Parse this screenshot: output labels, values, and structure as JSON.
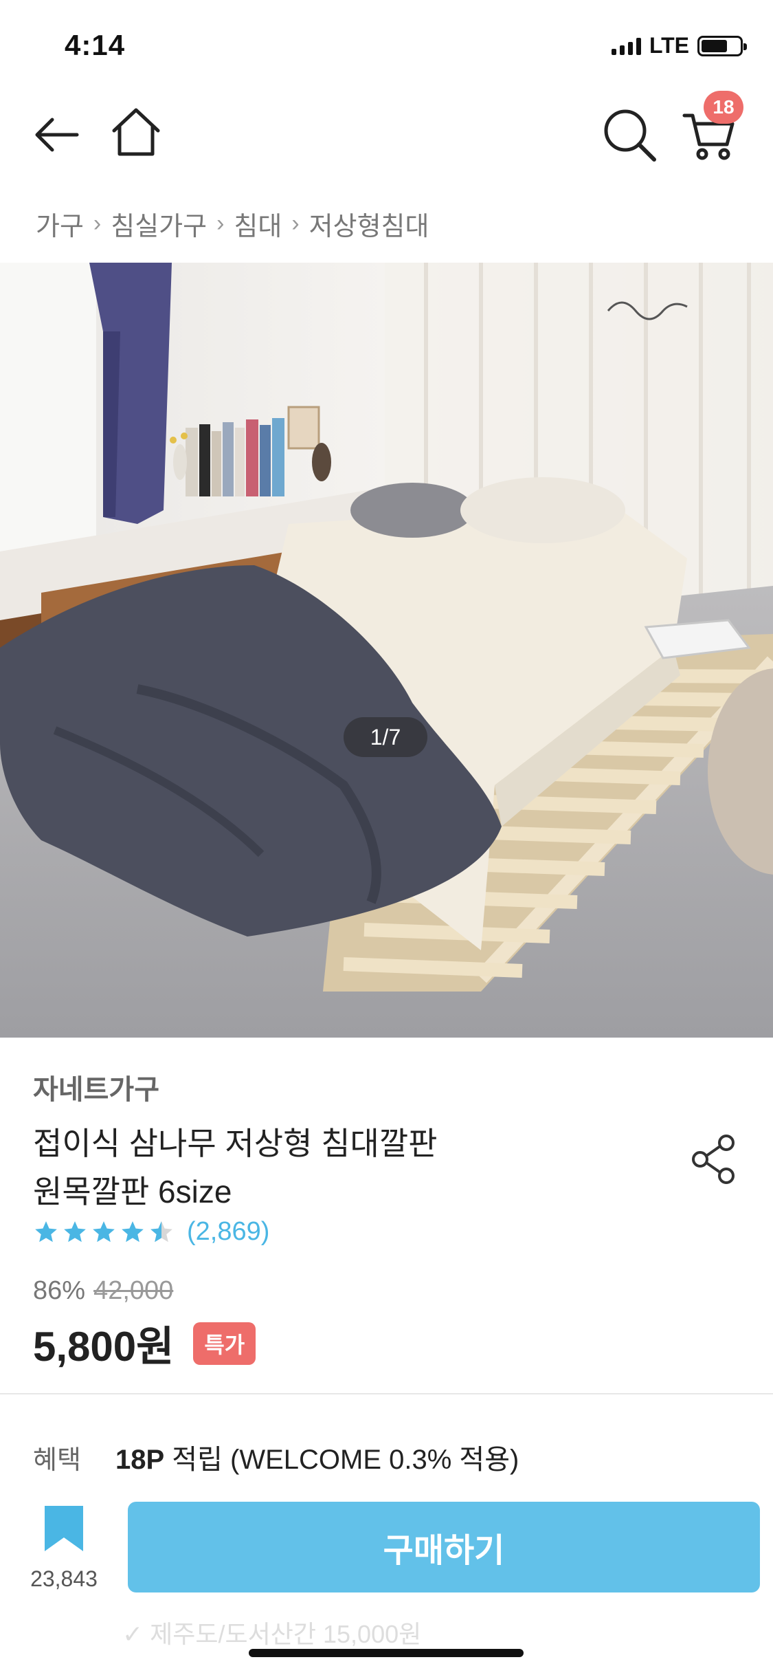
{
  "status_bar": {
    "time": "4:14",
    "network": "LTE"
  },
  "header": {
    "cart_count": "18"
  },
  "breadcrumb": [
    "가구",
    "침실가구",
    "침대",
    "저상형침대"
  ],
  "hero": {
    "image_counter": "1/7"
  },
  "product": {
    "seller": "자네트가구",
    "title_line1": "접이식 삼나무 저상형 침대깔판",
    "title_line2": "원목깔판 6size",
    "rating": 4.5,
    "review_count": "(2,869)",
    "discount_rate": "86%",
    "original_price": "42,000",
    "price": "5,800원",
    "badge": "특가"
  },
  "benefit": {
    "label": "혜택",
    "points": "18P",
    "detail": " 적립 (WELCOME 0.3% 적용)"
  },
  "shipping": {
    "note": "✓ 제주도/도서산간 15,000원"
  },
  "bottom_bar": {
    "bookmark_count": "23,843",
    "buy_label": "구매하기"
  },
  "colors": {
    "accent": "#62c1e9",
    "badge": "#ee6d6a",
    "star": "#4ab6e4"
  }
}
